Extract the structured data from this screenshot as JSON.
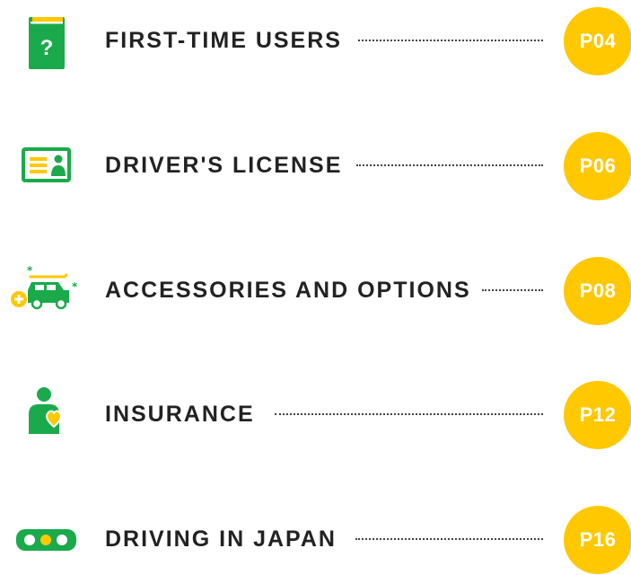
{
  "colors": {
    "accent_green": "#1aaa4b",
    "accent_yellow": "#ffc800",
    "text": "#222222",
    "dots": "#444444"
  },
  "toc": {
    "items": [
      {
        "icon": "question-book-icon",
        "title": "FIRST-TIME USERS",
        "page": "P04"
      },
      {
        "icon": "license-card-icon",
        "title": "DRIVER'S LICENSE",
        "page": "P06"
      },
      {
        "icon": "car-accessories-icon",
        "title": "ACCESSORIES AND OPTIONS",
        "page": "P08"
      },
      {
        "icon": "person-heart-icon",
        "title": "INSURANCE",
        "page": "P12"
      },
      {
        "icon": "traffic-light-icon",
        "title": "DRIVING IN JAPAN",
        "page": "P16"
      }
    ]
  }
}
